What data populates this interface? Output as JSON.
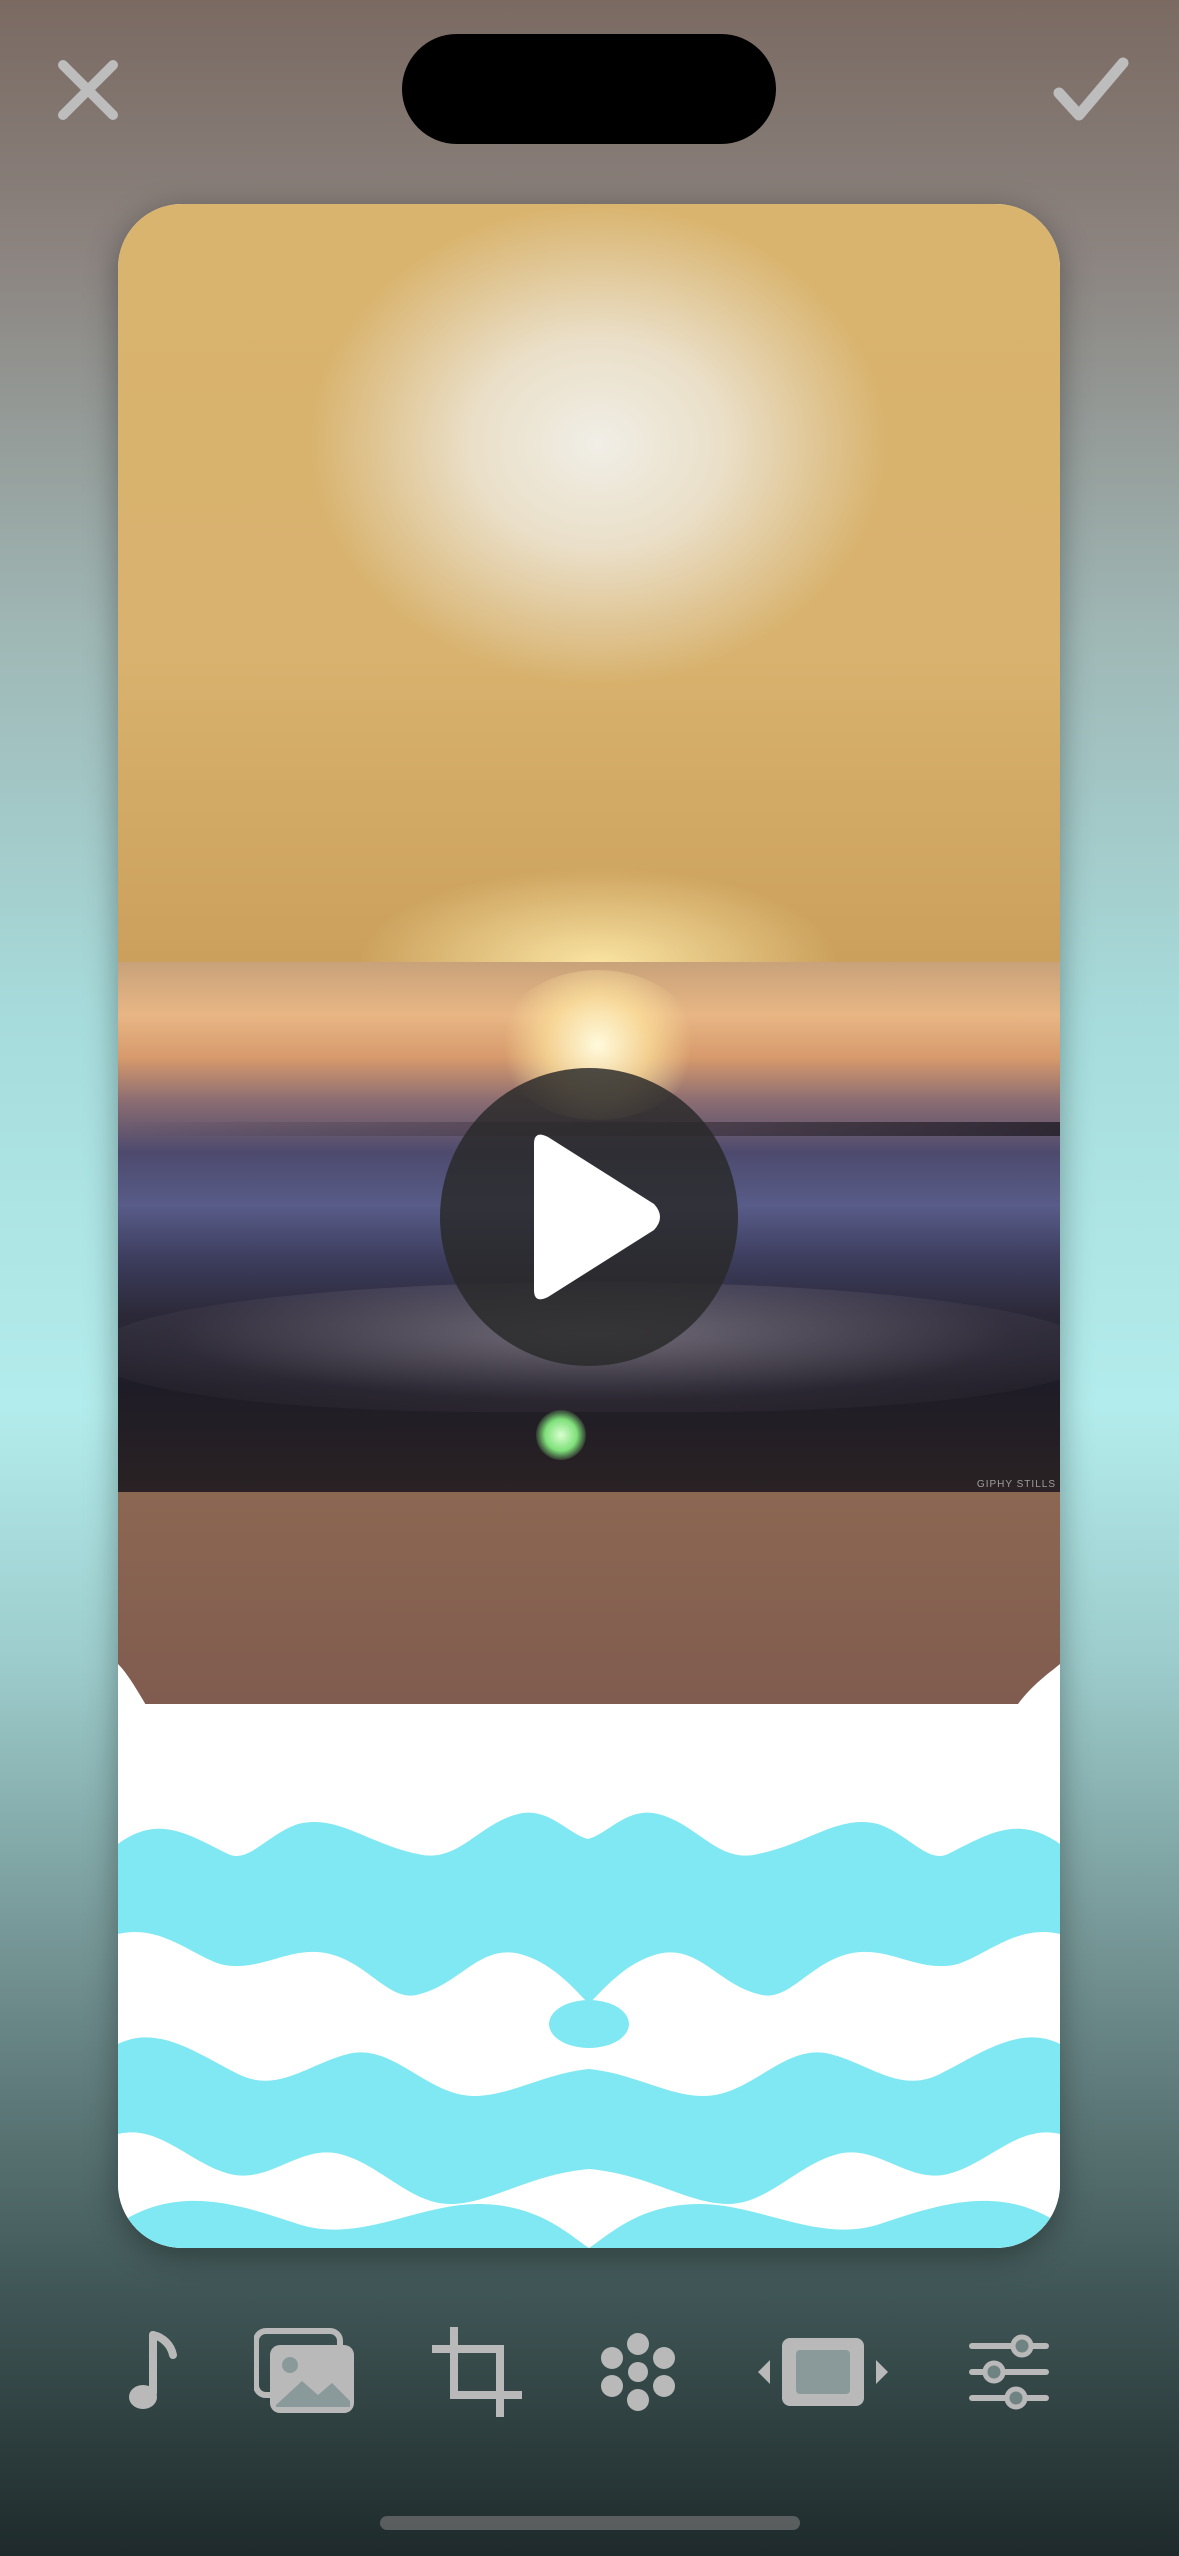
{
  "header": {
    "close_icon": "close-icon",
    "confirm_icon": "checkmark-icon"
  },
  "canvas": {
    "video": {
      "watermark": "GIPHY STILLS",
      "play_icon": "play-icon"
    }
  },
  "toolbar": {
    "items": [
      {
        "name": "music",
        "icon": "music-note-icon"
      },
      {
        "name": "photos",
        "icon": "photo-stack-icon"
      },
      {
        "name": "crop",
        "icon": "crop-icon"
      },
      {
        "name": "effects",
        "icon": "dots-flower-icon"
      },
      {
        "name": "frame",
        "icon": "frame-resize-icon"
      },
      {
        "name": "adjust",
        "icon": "sliders-icon"
      }
    ]
  },
  "colors": {
    "icon_gray": "#b9b9b9",
    "wave_cyan": "#7fe8f2",
    "play_bg": "#282828"
  }
}
